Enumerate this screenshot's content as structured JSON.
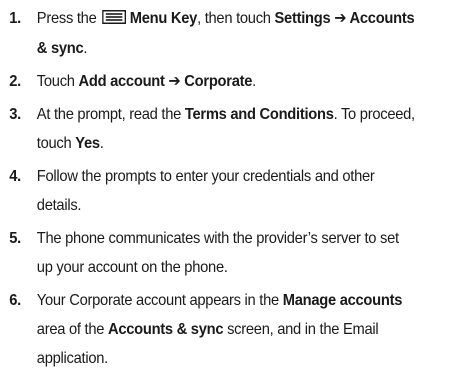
{
  "steps": [
    {
      "num": "1.",
      "parts": [
        {
          "t": "Press the "
        },
        {
          "icon": "menu-key-icon"
        },
        {
          "t": "Menu Key",
          "b": true
        },
        {
          "t": ", then touch "
        },
        {
          "t": "Settings ➔ Accounts & sync",
          "b": true
        },
        {
          "t": "."
        }
      ]
    },
    {
      "num": "2.",
      "parts": [
        {
          "t": "Touch "
        },
        {
          "t": "Add account ➔ Corporate",
          "b": true
        },
        {
          "t": "."
        }
      ]
    },
    {
      "num": "3.",
      "parts": [
        {
          "t": "At the prompt, read the "
        },
        {
          "t": "Terms and Conditions",
          "b": true
        },
        {
          "t": ". To proceed, touch "
        },
        {
          "t": "Yes",
          "b": true
        },
        {
          "t": "."
        }
      ]
    },
    {
      "num": "4.",
      "parts": [
        {
          "t": "Follow the prompts to enter your credentials and other details."
        }
      ]
    },
    {
      "num": "5.",
      "parts": [
        {
          "t": "The phone communicates with the provider’s server to set up your account on the phone."
        }
      ]
    },
    {
      "num": "6.",
      "parts": [
        {
          "t": "Your Corporate account appears in the "
        },
        {
          "t": "Manage accounts",
          "b": true
        },
        {
          "t": " area of the "
        },
        {
          "t": "Accounts & sync",
          "b": true
        },
        {
          "t": " screen, and in the Email application."
        }
      ]
    }
  ]
}
